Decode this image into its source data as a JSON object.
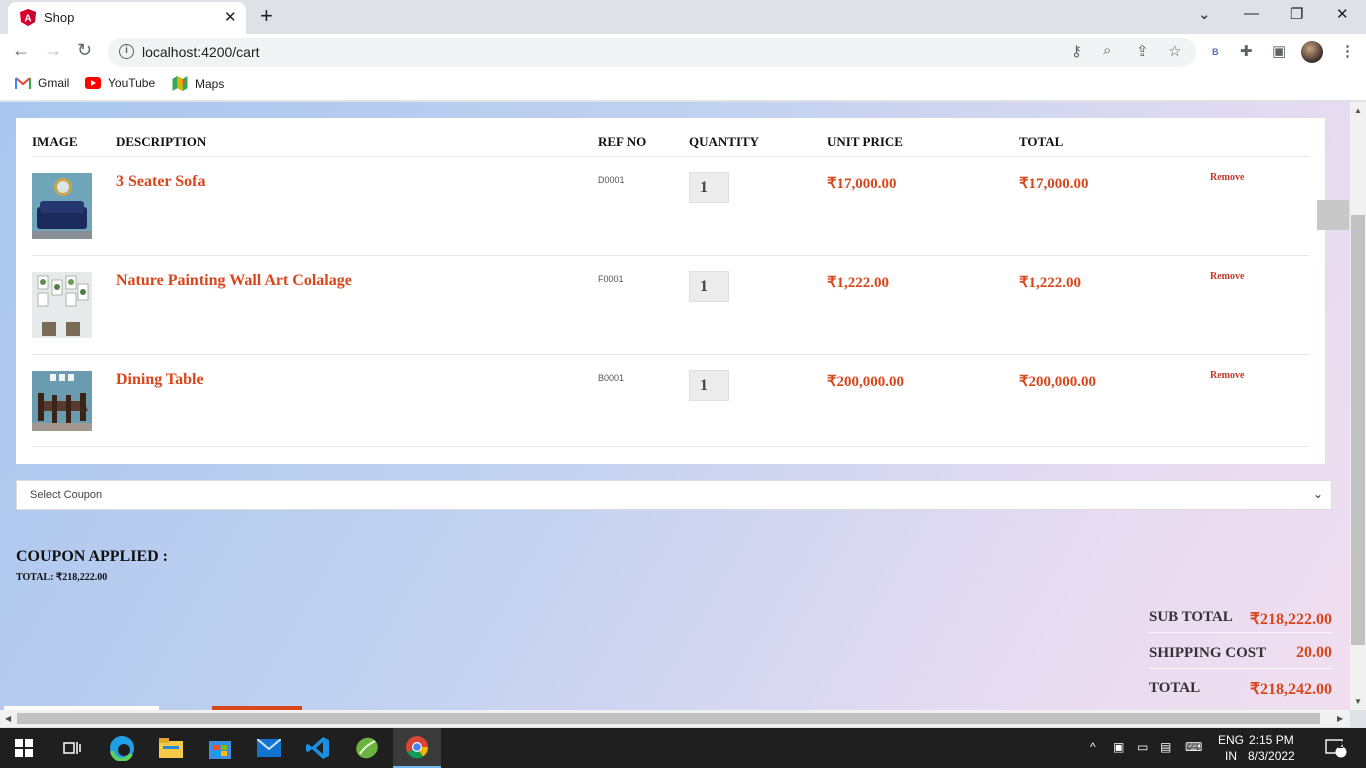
{
  "browser": {
    "tab_title": "Shop",
    "url": "localhost:4200/cart",
    "bookmarks": [
      {
        "label": "Gmail",
        "icon": "gmail-icon"
      },
      {
        "label": "YouTube",
        "icon": "youtube-icon"
      },
      {
        "label": "Maps",
        "icon": "maps-icon"
      }
    ],
    "toolbar_icons": [
      "key-icon",
      "zoom-icon",
      "share-icon",
      "star-icon",
      "extension-b-icon",
      "puzzle-icon",
      "sidepanel-icon",
      "profile-avatar",
      "more-icon"
    ],
    "extension_badge": "B"
  },
  "cart": {
    "headers": {
      "image": "IMAGE",
      "description": "DESCRIPTION",
      "ref_no": "REF NO",
      "quantity": "QUANTITY",
      "unit_price": "UNIT PRICE",
      "total": "TOTAL"
    },
    "items": [
      {
        "description": "3 Seater Sofa",
        "ref": "D0001",
        "qty": "1",
        "unit_price": "₹17,000.00",
        "total": "₹17,000.00",
        "remove": "Remove"
      },
      {
        "description": "Nature Painting Wall Art Colalage",
        "ref": "F0001",
        "qty": "1",
        "unit_price": "₹1,222.00",
        "total": "₹1,222.00",
        "remove": "Remove"
      },
      {
        "description": "Dining Table",
        "ref": "B0001",
        "qty": "1",
        "unit_price": "₹200,000.00",
        "total": "₹200,000.00",
        "remove": "Remove"
      }
    ]
  },
  "coupon": {
    "select_placeholder": "Select Coupon",
    "applied_title": "COUPON APPLIED :",
    "total_line": "TOTAL: ₹218,222.00"
  },
  "summary": {
    "subtotal_label": "SUB TOTAL",
    "subtotal_value": "₹218,222.00",
    "shipping_label": "SHIPPING COST",
    "shipping_value": "20.00",
    "total_label": "TOTAL",
    "total_value": "₹218,242.00"
  },
  "taskbar": {
    "lang_line1": "ENG",
    "lang_line2": "IN",
    "time": "2:15 PM",
    "date": "8/3/2022",
    "notification_count": "2"
  },
  "colors": {
    "accent": "#d9461b",
    "gradient_start": "#a9c6ee",
    "gradient_end": "#f0def0"
  }
}
